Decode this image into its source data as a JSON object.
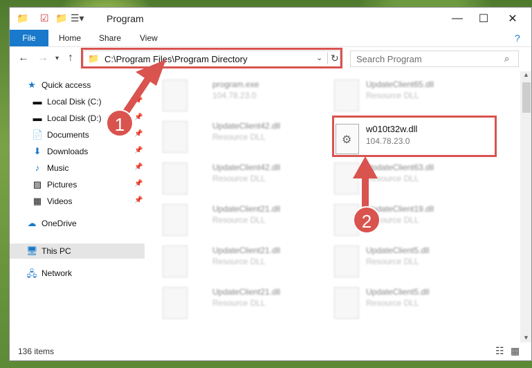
{
  "window": {
    "title": "Program"
  },
  "ribbon": {
    "tabs": [
      "File",
      "Home",
      "Share",
      "View"
    ]
  },
  "address": {
    "path": "C:\\Program Files\\Program Directory"
  },
  "search": {
    "placeholder": "Search Program"
  },
  "sidebar": {
    "items": [
      {
        "label": "Quick access",
        "icon": "star-icon"
      },
      {
        "label": "Local Disk (C:)",
        "icon": "drive-icon"
      },
      {
        "label": "Local Disk (D:)",
        "icon": "drive-icon"
      },
      {
        "label": "Documents",
        "icon": "documents-icon"
      },
      {
        "label": "Downloads",
        "icon": "download-icon"
      },
      {
        "label": "Music",
        "icon": "music-icon"
      },
      {
        "label": "Pictures",
        "icon": "pictures-icon"
      },
      {
        "label": "Videos",
        "icon": "videos-icon"
      },
      {
        "label": "OneDrive",
        "icon": "cloud-icon"
      },
      {
        "label": "This PC",
        "icon": "computer-icon"
      },
      {
        "label": "Network",
        "icon": "network-icon"
      }
    ]
  },
  "files": [
    {
      "name": "program.exe",
      "sub": "104.78.23.0"
    },
    {
      "name": "UpdateClient65.dll",
      "sub": "Resource DLL"
    },
    {
      "name": "UpdateClient42.dll",
      "sub": "Resource DLL"
    },
    {
      "name": "w010t32w.dll",
      "sub": "104.78.23.0"
    },
    {
      "name": "UpdateClient42.dll",
      "sub": "Resource DLL"
    },
    {
      "name": "UpdateClient63.dll",
      "sub": "Resource DLL"
    },
    {
      "name": "UpdateClient21.dll",
      "sub": "Resource DLL"
    },
    {
      "name": "UpdateClient19.dll",
      "sub": "Resource DLL"
    },
    {
      "name": "UpdateClient21.dll",
      "sub": "Resource DLL"
    },
    {
      "name": "UpdateClient5.dll",
      "sub": "Resource DLL"
    },
    {
      "name": "UpdateClient21.dll",
      "sub": "Resource DLL"
    },
    {
      "name": "UpdateClient5.dll",
      "sub": "Resource DLL"
    }
  ],
  "status": {
    "count": "136 items"
  },
  "annotations": {
    "marker1": "1",
    "marker2": "2",
    "color": "#d9534f"
  }
}
